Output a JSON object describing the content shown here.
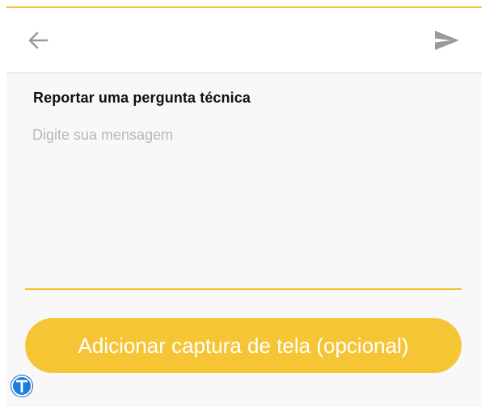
{
  "header": {
    "back_icon": "arrow-left-icon",
    "send_icon": "send-icon"
  },
  "form": {
    "title": "Reportar uma pergunta técnica",
    "message_placeholder": "Digite sua mensagem",
    "message_value": ""
  },
  "actions": {
    "add_screenshot_label": "Adicionar captura de tela (opcional)"
  },
  "badge": {
    "icon": "translate-t-icon"
  },
  "colors": {
    "accent": "#f3c12e",
    "button": "#f6c536",
    "button_text": "#ffffff",
    "icon_gray": "#9a9a9a",
    "content_background": "#f8f8f8",
    "placeholder": "#b8b8b8",
    "badge": "#1a7de0"
  }
}
